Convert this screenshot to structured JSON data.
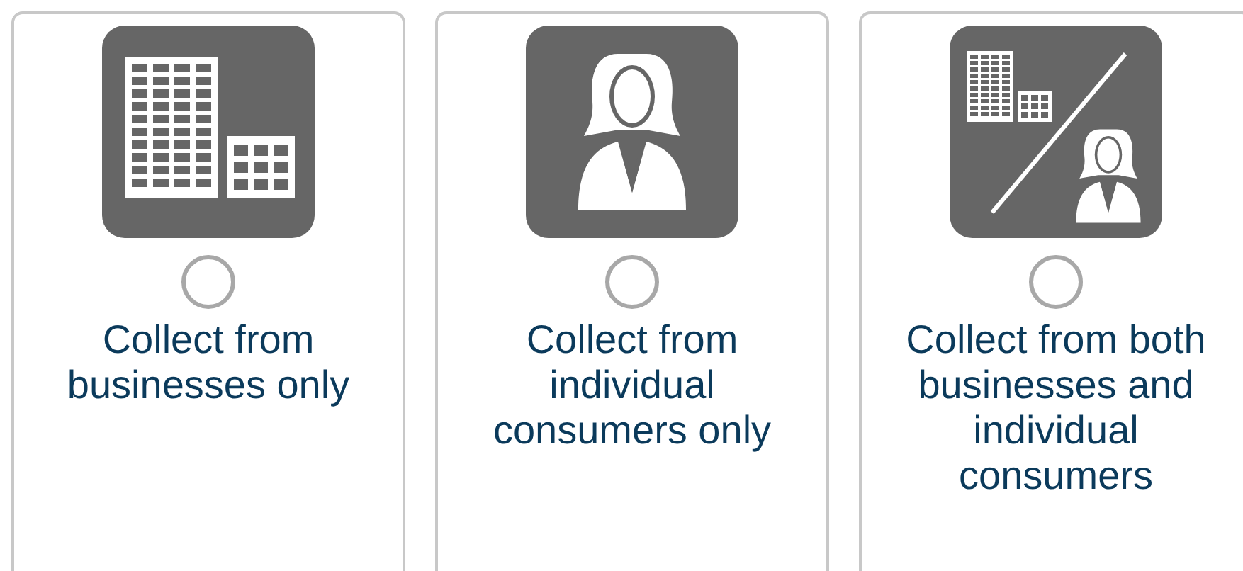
{
  "options": [
    {
      "kind": "businesses",
      "label": "Collect from businesses only",
      "selected": false
    },
    {
      "kind": "consumers",
      "label": "Collect from individual consumers only",
      "selected": false
    },
    {
      "kind": "both",
      "label": "Collect from both businesses and individual consumers",
      "selected": false
    }
  ]
}
